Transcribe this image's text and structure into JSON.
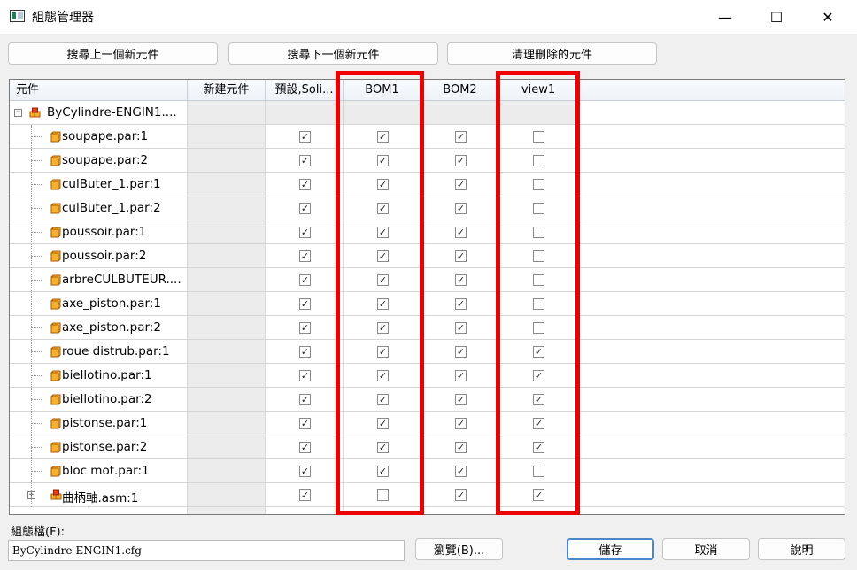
{
  "window": {
    "title": "組態管理器",
    "min_symbol": "—",
    "max_symbol": "☐",
    "close_symbol": "✕"
  },
  "toolbar": {
    "prev_label": "搜尋上一個新元件",
    "next_label": "搜尋下一個新元件",
    "clean_label": "清理刪除的元件"
  },
  "grid": {
    "columns": [
      "元件",
      "新建元件",
      "預設,Soli...",
      "BOM1",
      "BOM2",
      "view1"
    ],
    "root": {
      "name": "ByCylindre-ENGIN1....",
      "expander": "−"
    },
    "rows": [
      {
        "name": "soupape.par:1",
        "default": true,
        "bom1": true,
        "bom2": true,
        "view1": false
      },
      {
        "name": "soupape.par:2",
        "default": true,
        "bom1": true,
        "bom2": true,
        "view1": false
      },
      {
        "name": "culButer_1.par:1",
        "default": true,
        "bom1": true,
        "bom2": true,
        "view1": false
      },
      {
        "name": "culButer_1.par:2",
        "default": true,
        "bom1": true,
        "bom2": true,
        "view1": false
      },
      {
        "name": "poussoir.par:1",
        "default": true,
        "bom1": true,
        "bom2": true,
        "view1": false
      },
      {
        "name": "poussoir.par:2",
        "default": true,
        "bom1": true,
        "bom2": true,
        "view1": false
      },
      {
        "name": "arbreCULBUTEUR....",
        "default": true,
        "bom1": true,
        "bom2": true,
        "view1": false
      },
      {
        "name": "axe_piston.par:1",
        "default": true,
        "bom1": true,
        "bom2": true,
        "view1": false
      },
      {
        "name": "axe_piston.par:2",
        "default": true,
        "bom1": true,
        "bom2": true,
        "view1": false
      },
      {
        "name": "roue distrub.par:1",
        "default": true,
        "bom1": true,
        "bom2": true,
        "view1": true
      },
      {
        "name": "biellotino.par:1",
        "default": true,
        "bom1": true,
        "bom2": true,
        "view1": true
      },
      {
        "name": "biellotino.par:2",
        "default": true,
        "bom1": true,
        "bom2": true,
        "view1": true
      },
      {
        "name": "pistonse.par:1",
        "default": true,
        "bom1": true,
        "bom2": true,
        "view1": true
      },
      {
        "name": "pistonse.par:2",
        "default": true,
        "bom1": true,
        "bom2": true,
        "view1": true
      },
      {
        "name": "bloc mot.par:1",
        "default": true,
        "bom1": true,
        "bom2": true,
        "view1": false
      },
      {
        "name": "曲柄軸.asm:1",
        "assembly": true,
        "expander": "+",
        "default": true,
        "bom1": false,
        "bom2": true,
        "view1": true
      }
    ]
  },
  "footer": {
    "config_label": "組態檔(F):",
    "config_value": "ByCylindre-ENGIN1.cfg",
    "browse_label": "瀏覽(B)...",
    "save_label": "儲存",
    "cancel_label": "取消",
    "help_label": "說明"
  },
  "colors": {
    "highlight": "#ee0000",
    "part_icon": "#f0a020",
    "assembly_icon": "#e07020"
  }
}
